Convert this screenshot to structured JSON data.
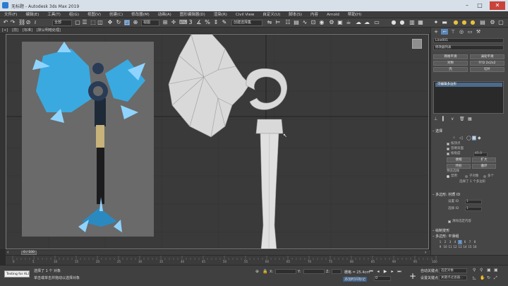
{
  "window": {
    "title": "无标题 - Autodesk 3ds Max 2019",
    "minimize": "–",
    "maximize": "□",
    "close": "✕"
  },
  "menu": {
    "items": [
      "文件(F)",
      "编辑(E)",
      "工具(T)",
      "组(G)",
      "视图(V)",
      "创建(C)",
      "修改器(M)",
      "动画(A)",
      "图形编辑器(D)",
      "渲染(R)",
      "Civil View",
      "自定义(U)",
      "脚本(S)",
      "内容",
      "Arnold",
      "帮助(H)"
    ],
    "workspace_label": "登录"
  },
  "toolbar": {
    "selection_set_placeholder": "全部",
    "ref_coord": "视图",
    "named_selection": "创建选择集"
  },
  "subbar": {
    "items": [
      "[+]",
      "[前]",
      "[标准]",
      "[默认明暗处理]"
    ]
  },
  "command_panel": {
    "object_name": "Line001",
    "modifier_list": "修改器列表",
    "buttons": [
      "网格平滑",
      "涡轮平滑",
      "对称",
      "FFD 2x2x2",
      "壳",
      "切片"
    ],
    "stack_item": "可编辑多边形",
    "selection_header": "选择",
    "selection_options": [
      "按顶点",
      "忽略背面",
      "按角度"
    ],
    "angle_value": "45.0",
    "shrink": "收缩",
    "grow": "扩大",
    "ring": "环形",
    "loop": "循环",
    "preview_label": "预览选择",
    "preview_off": "禁用",
    "preview_sub": "子对象",
    "preview_multi": "多个",
    "selected_status": "选择了 1 个多边形",
    "soft_header": "多边形: 材质 ID",
    "set_id_label": "设置 ID",
    "select_id_label": "选择 ID",
    "set_id_value": "1",
    "select_id_value": "1",
    "clear_label": "清除选定内容",
    "smoothing_header": "绘制变形",
    "smoothing_groups_header": "多边形: 平滑组",
    "smoothing_groups": [
      "1",
      "2",
      "3",
      "4",
      "5",
      "6",
      "7",
      "8",
      "9",
      "10",
      "11",
      "12",
      "13",
      "14",
      "15",
      "16"
    ]
  },
  "timeline": {
    "frame_display": "0 / 100",
    "ticks": [
      "0",
      "5",
      "10",
      "15",
      "20",
      "25",
      "30",
      "35",
      "40",
      "45",
      "50",
      "55",
      "60",
      "65",
      "70",
      "75",
      "80",
      "85",
      "90",
      "95",
      "100"
    ]
  },
  "status": {
    "maxscript": "Testing for ALI",
    "line1": "选择了 1 个 对象",
    "line2": "单击或单击并拖动以选择对象",
    "grid_label": "栅格 = 25.4cm",
    "autokey": "自动关键点",
    "setkey": "设置关键点",
    "selected_dropdown": "选定对象",
    "key_filters": "关键点过滤器...",
    "add_time_tag": "添加时间标记",
    "x": "X:",
    "y": "Y:",
    "z": "Z:",
    "frame": "0"
  },
  "colors": {
    "viewport_bg": "#3a3a3a",
    "reference_bg": "#6a6a6a",
    "accent_blue": "#4c6a8a",
    "close_red": "#c9433a"
  }
}
